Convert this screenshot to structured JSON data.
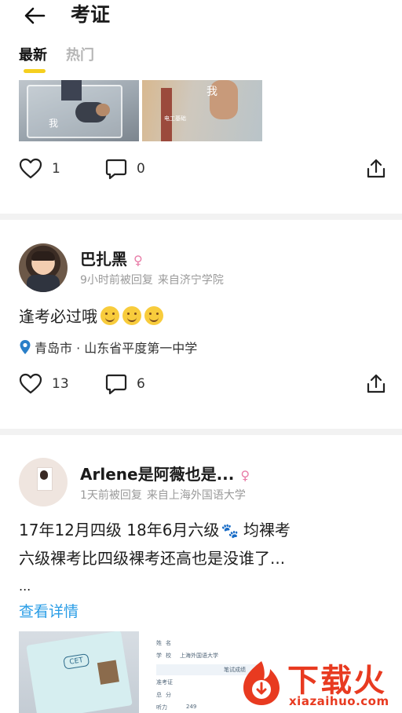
{
  "header": {
    "title": "考证"
  },
  "tabs": [
    {
      "label": "最新",
      "active": true
    },
    {
      "label": "热门",
      "active": false
    }
  ],
  "post1": {
    "images": [
      {
        "overlay": "我"
      },
      {
        "overlay": "我",
        "sub": "电工基础"
      }
    ],
    "likes": "1",
    "comments": "0"
  },
  "post2": {
    "username": "巴扎黑",
    "gender_symbol": "♀",
    "meta_time": "9小时前被回复",
    "meta_school": "来自济宁学院",
    "content": "逢考必过哦",
    "emoji_count": 3,
    "location": "青岛市 · 山东省平度第一中学",
    "likes": "13",
    "comments": "6"
  },
  "post3": {
    "username": "Arlene是阿薇也是...",
    "gender_symbol": "♀",
    "meta_time": "1天前被回复",
    "meta_school": "来自上海外国语大学",
    "line1_a": "17年12月四级 18年6月六级",
    "paw": "🐾",
    "line1_b": "均裸考",
    "line2": "六级裸考比四级裸考还高也是没谁了...",
    "line3": "...",
    "more_link": "查看详情",
    "cert_label": "CET",
    "card_labels": [
      "姓",
      "名",
      "学",
      "校",
      "上海外国语大学",
      "笔试成绩",
      "准考证",
      "总",
      "分",
      "听力",
      "249"
    ]
  },
  "watermark": {
    "cn": "下载火",
    "en": "xiazaihuo.com"
  },
  "colors": {
    "accent_yellow": "#f5cf1f",
    "link_blue": "#2a9de6",
    "gender_pink": "#e87ca7",
    "watermark_red": "#e83a20",
    "muted_text": "#9a9a9a"
  },
  "icons": [
    "back-arrow-icon",
    "heart-icon",
    "comment-icon",
    "share-icon",
    "location-pin-icon",
    "smile-emoji-icon",
    "paw-icon",
    "gender-female-icon"
  ]
}
